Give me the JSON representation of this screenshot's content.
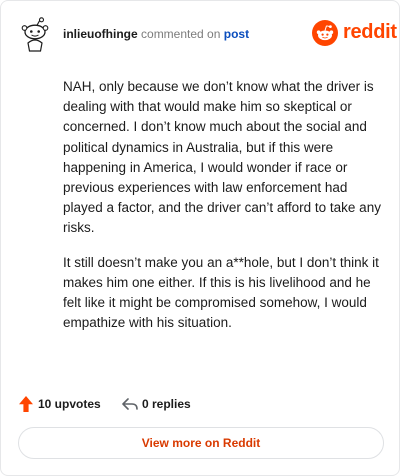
{
  "header": {
    "username": "inlieuofhinge",
    "action_text": "commented on",
    "post_link": "post",
    "brand_word": "reddit"
  },
  "comment": {
    "paragraphs": [
      "NAH, only because we don’t know what the driver is dealing with that would make him so skeptical or concerned. I don’t know much about the social and political dynamics in Australia, but if this were happening in America, I would wonder if race or previous experiences with law enforcement had played a factor, and the driver can’t afford to take any risks.",
      "It still doesn’t make you an a**hole, but I don’t think it makes him one either. If this is his livelihood and he felt like it might be compromised somehow, I would empathize with his situation."
    ]
  },
  "footer": {
    "upvotes_label": "10 upvotes",
    "replies_label": "0 replies",
    "view_more_label": "View more on Reddit"
  },
  "icons": {
    "avatar": "snoo-avatar-icon",
    "brand": "reddit-logo-icon",
    "upvote": "upvote-arrow-icon",
    "reply": "reply-arrow-icon"
  },
  "colors": {
    "brand": "#ff4500",
    "upvote": "#ff4500",
    "link": "#0a4dbd",
    "view_more_text": "#d93a00"
  }
}
